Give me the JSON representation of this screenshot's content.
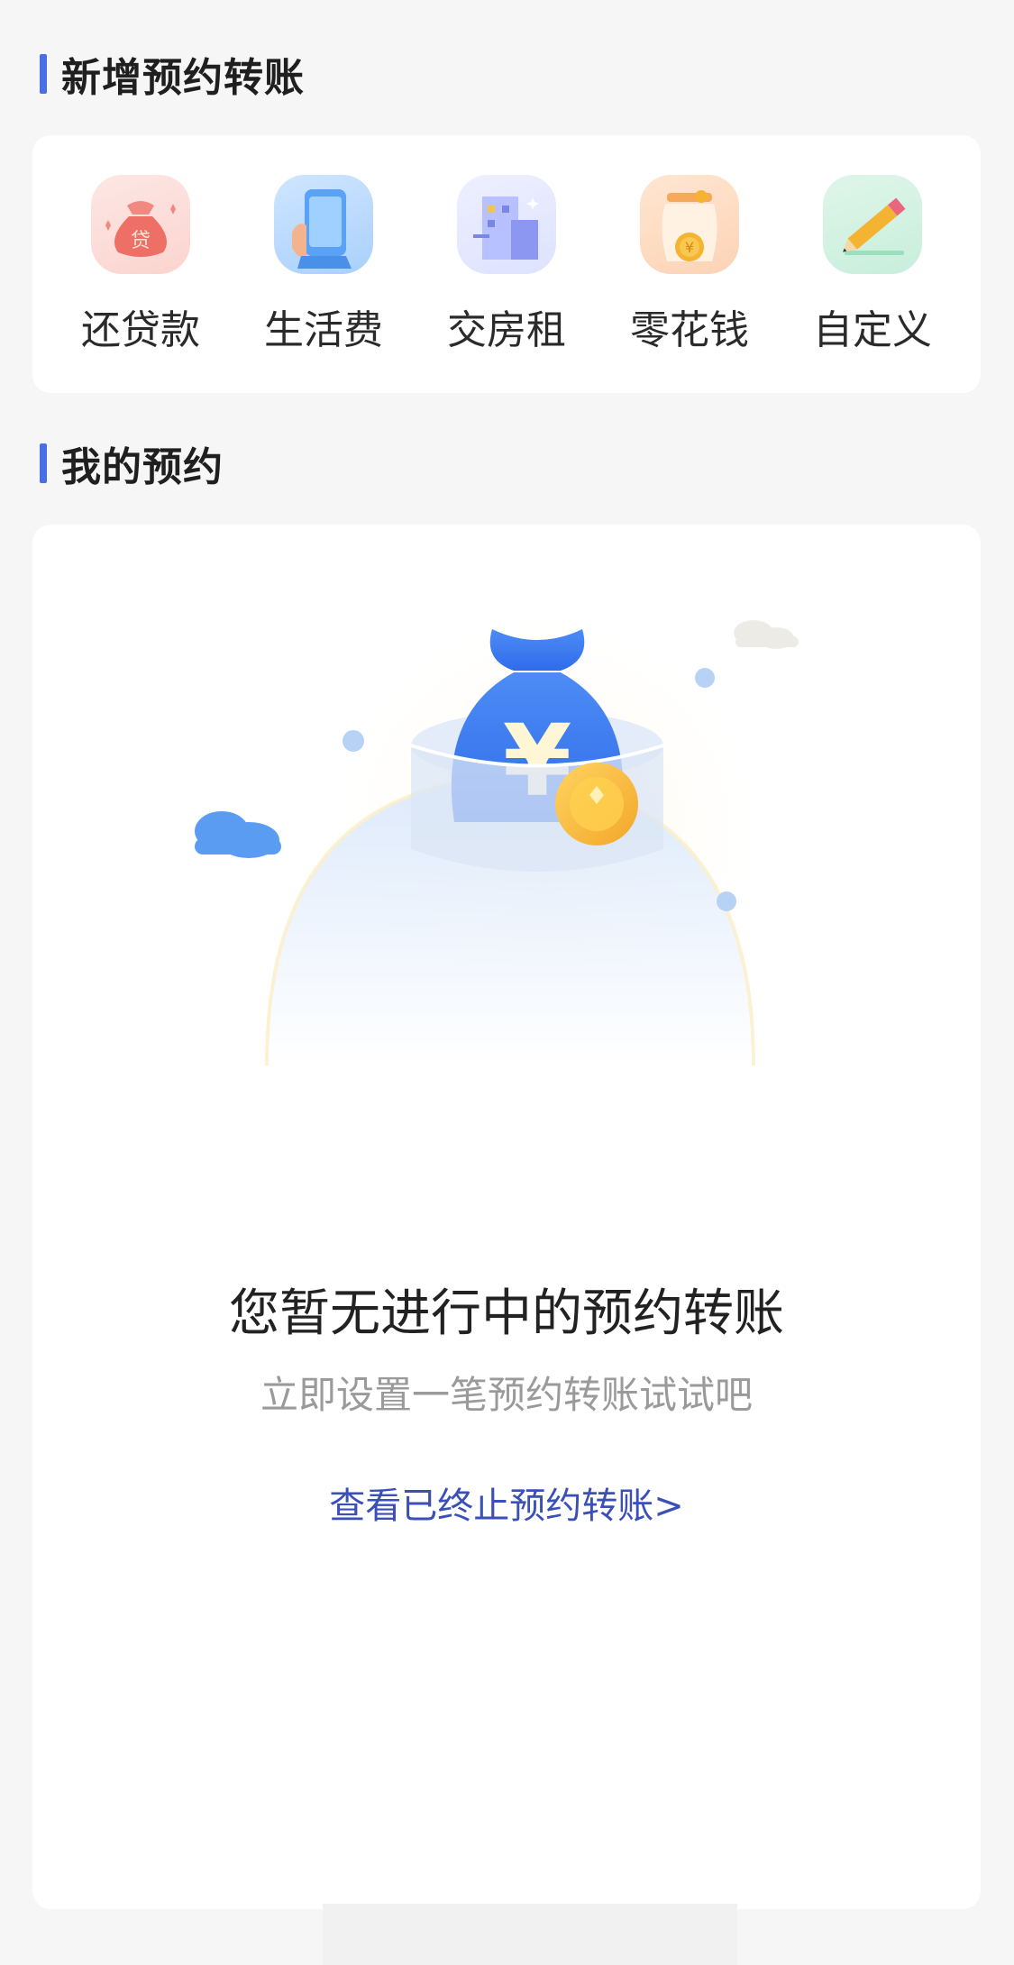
{
  "sections": {
    "new_title": "新增预约转账",
    "mine_title": "我的预约"
  },
  "quick_actions": [
    {
      "label": "还贷款",
      "icon": "loan-bag-icon",
      "bag_char": "贷"
    },
    {
      "label": "生活费",
      "icon": "phone-in-hand-icon"
    },
    {
      "label": "交房租",
      "icon": "building-icon"
    },
    {
      "label": "零花钱",
      "icon": "coin-jar-icon",
      "coin_char": "¥"
    },
    {
      "label": "自定义",
      "icon": "pencil-icon"
    }
  ],
  "empty_state": {
    "illustration_icon": "money-bag-icon",
    "currency_char": "¥",
    "title": "您暂无进行中的预约转账",
    "subtitle": "立即设置一笔预约转账试试吧",
    "link": "查看已终止预约转账>"
  },
  "colors": {
    "accent": "#4a6fe3",
    "link": "#3b4fb8",
    "background": "#f6f6f6"
  }
}
